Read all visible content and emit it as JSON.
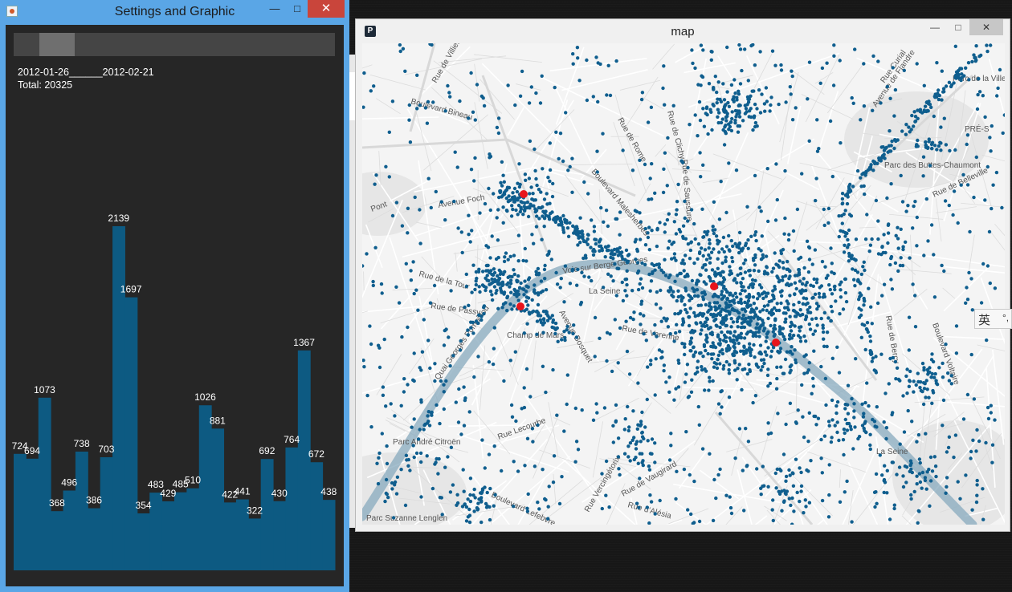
{
  "settings_window": {
    "title": "Settings and Graphic",
    "range_start": "2012-01-26",
    "range_sep": "______",
    "range_end": "2012-02-21",
    "total_label": "Total: 20325",
    "slider": {
      "start_fraction": 0.08,
      "end_fraction": 0.19
    },
    "bar_color": "#0d5a82",
    "chart_data": {
      "type": "bar",
      "values": [
        724,
        694,
        1073,
        368,
        496,
        738,
        386,
        703,
        2139,
        1697,
        354,
        483,
        429,
        485,
        510,
        1026,
        881,
        422,
        441,
        322,
        692,
        430,
        764,
        1367,
        672,
        438
      ],
      "ylim": [
        0,
        2139
      ]
    }
  },
  "map_window": {
    "title": "map",
    "labels": [
      "Rue de Villiers",
      "Boulevard Bineau",
      "Rue de Rome",
      "Rue de Clichy",
      "Rue de Saussure",
      "Boulevard Malesherbes",
      "Avenue Foch",
      "Rue de la Tour",
      "Rue de Passy",
      "Champ de Mars",
      "La Seine",
      "Voie sur Berge Georges",
      "Rue de Varenne",
      "Avenue Bosquet",
      "Quai Georges Pompidou",
      "Parc André Citroën",
      "Rue Lecourbe",
      "Boulevard Lefebvre",
      "Rue de Vaugirard",
      "Rue Vercingétorix",
      "Rue d'Alésia",
      "Parc Suzanne Lenglen",
      "La Seine",
      "Parc de la Villette",
      "Avenue de Flandre",
      "Rue Curial",
      "Parc des Buttes-Chaumont",
      "Rue de Belleville",
      "Boulevard Voltaire",
      "Rue de Bercy",
      "PRÉ-S",
      "Pont"
    ],
    "ime_label": "英",
    "ime_mark": "°,",
    "colors": {
      "points": "#0f5e8e",
      "hotspots": "#e8141b",
      "river": "#87a9bd"
    }
  },
  "ui_colors": {
    "titlebar": "#5aa6e6",
    "close": "#c9453b"
  }
}
